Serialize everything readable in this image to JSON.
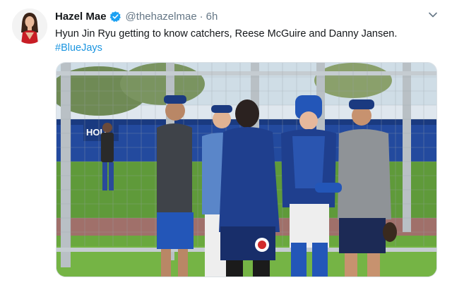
{
  "author": {
    "display_name": "Hazel Mae",
    "handle": "@thehazelmae",
    "separator": "·",
    "timestamp": "6h",
    "verified": true
  },
  "tweet": {
    "text": "Hyun Jin Ryu getting to know catchers, Reese McGuire and Danny Jansen.",
    "hashtag": "#BlueJays"
  },
  "media": {
    "wall_sign": "HOU"
  },
  "colors": {
    "verified_blue": "#1da1f2",
    "link_blue": "#1b95e0",
    "jays_blue": "#1f3f8e",
    "field_green": "#6aa83e"
  },
  "icons": {
    "verified": "verified-badge-icon",
    "caret": "chevron-down-icon"
  }
}
